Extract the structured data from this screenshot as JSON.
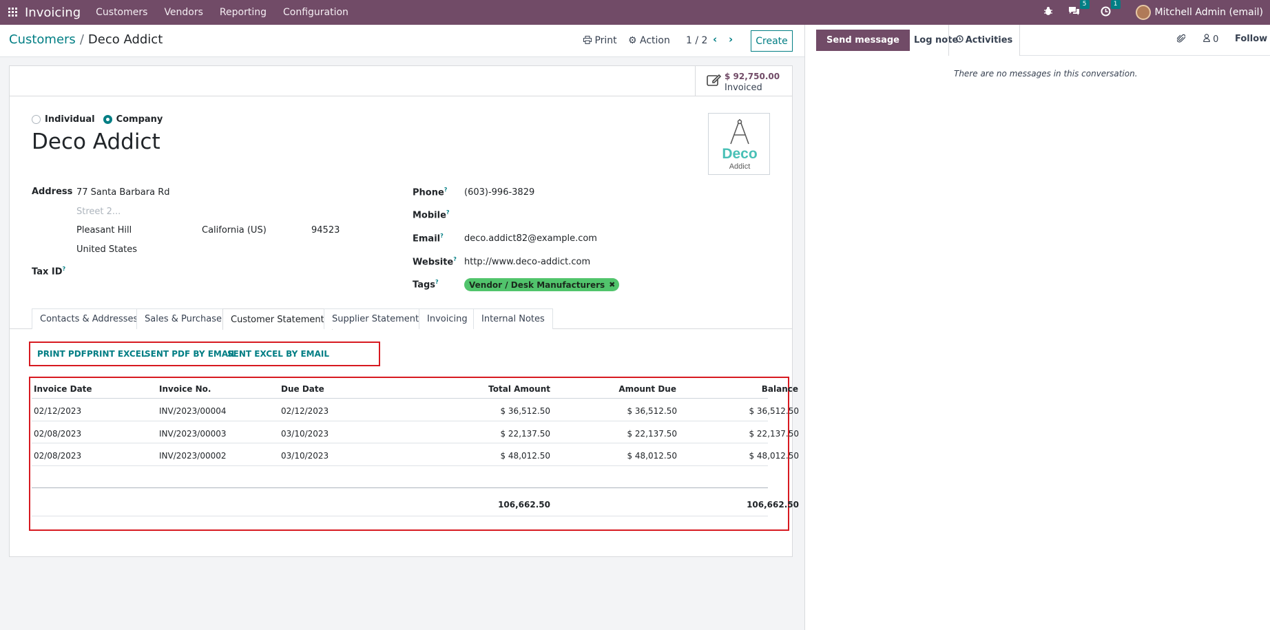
{
  "navbar": {
    "app_name": "Invoicing",
    "menus": [
      "Customers",
      "Vendors",
      "Reporting",
      "Configuration"
    ],
    "messages_count": "5",
    "activities_count": "1",
    "user": "Mitchell Admin (email)"
  },
  "control_panel": {
    "breadcrumb_parent": "Customers",
    "breadcrumb_sep": "/",
    "breadcrumb_current": "Deco Addict",
    "print_label": "Print",
    "action_label": "Action",
    "pager": "1 / 2",
    "create_label": "Create"
  },
  "stat_button": {
    "value": "$ 92,750.00",
    "label": "Invoiced"
  },
  "company_type": {
    "individual_label": "Individual",
    "company_label": "Company",
    "selected": "Company"
  },
  "partner": {
    "name": "Deco Addict",
    "logo_text_main": "Deco",
    "logo_text_sub": "Addict",
    "address_label": "Address",
    "street": "77 Santa Barbara Rd",
    "street2_placeholder": "Street 2...",
    "city": "Pleasant Hill",
    "state": "California (US)",
    "zip": "94523",
    "country": "United States",
    "tax_id_label": "Tax ID",
    "phone_label": "Phone",
    "phone": "(603)-996-3829",
    "mobile_label": "Mobile",
    "email_label": "Email",
    "email": "deco.addict82@example.com",
    "website_label": "Website",
    "website": "http://www.deco-addict.com",
    "tags_label": "Tags",
    "tag": "Vendor / Desk Manufacturers",
    "help_mark": "?"
  },
  "tabs": [
    "Contacts & Addresses",
    "Sales & Purchase",
    "Customer Statement",
    "Supplier Statement",
    "Invoicing",
    "Internal Notes"
  ],
  "active_tab": "Customer Statement",
  "statement_actions": [
    "PRINT PDF",
    "PRINT EXCEL",
    "SENT PDF BY EMAIL",
    "SENT EXCEL BY EMAIL"
  ],
  "statement_table": {
    "columns": [
      "Invoice Date",
      "Invoice No.",
      "Due Date",
      "Total Amount",
      "Amount Due",
      "Balance"
    ],
    "rows": [
      [
        "02/12/2023",
        "INV/2023/00004",
        "02/12/2023",
        "$ 36,512.50",
        "$ 36,512.50",
        "$ 36,512.50"
      ],
      [
        "02/08/2023",
        "INV/2023/00003",
        "03/10/2023",
        "$ 22,137.50",
        "$ 22,137.50",
        "$ 22,137.50"
      ],
      [
        "02/08/2023",
        "INV/2023/00002",
        "03/10/2023",
        "$ 48,012.50",
        "$ 48,012.50",
        "$ 48,012.50"
      ]
    ],
    "total_amount": "106,662.50",
    "total_balance": "106,662.50"
  },
  "chatter": {
    "send_message": "Send message",
    "log_note": "Log note",
    "activities": "Activities",
    "followers_count": "0",
    "follow": "Follow",
    "empty_text": "There are no messages in this conversation."
  },
  "colors": {
    "brand": "#714b67",
    "accent": "#017e84",
    "highlight_border": "#d71920",
    "tag": "#51c46c"
  }
}
